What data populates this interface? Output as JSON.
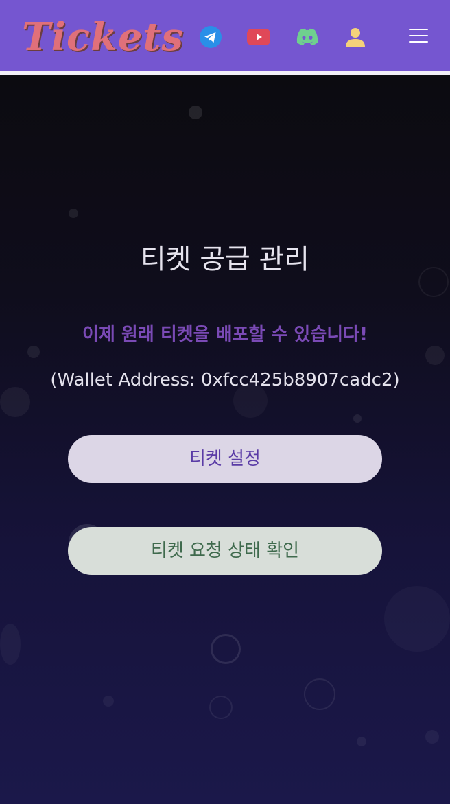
{
  "header": {
    "logo_text": "Tickets",
    "icons": {
      "telegram": "telegram-icon",
      "youtube": "youtube-icon",
      "discord": "discord-icon",
      "user": "user-icon",
      "menu": "hamburger-menu-icon"
    },
    "colors": {
      "background": "#7556d0",
      "logo": "#e0707a",
      "telegram": "#2a8fe8",
      "youtube": "#e04858",
      "discord": "#6fcf8f",
      "user": "#f5d27a"
    }
  },
  "main": {
    "title": "티켓 공급 관리",
    "subtitle": "이제 원래 티켓을 배포할 수 있습니다!",
    "wallet_text": "(Wallet Address: 0xfcc425b8907cadc2)",
    "buttons": {
      "settings_label": "티켓 설정",
      "status_label": "티켓 요청 상태 확인"
    },
    "colors": {
      "subtitle": "#7a4ab5",
      "settings_button_bg": "#dcd6e6",
      "settings_button_text": "#5a3ca6",
      "status_button_bg": "#d8ded9",
      "status_button_text": "#3f6a4d"
    }
  }
}
